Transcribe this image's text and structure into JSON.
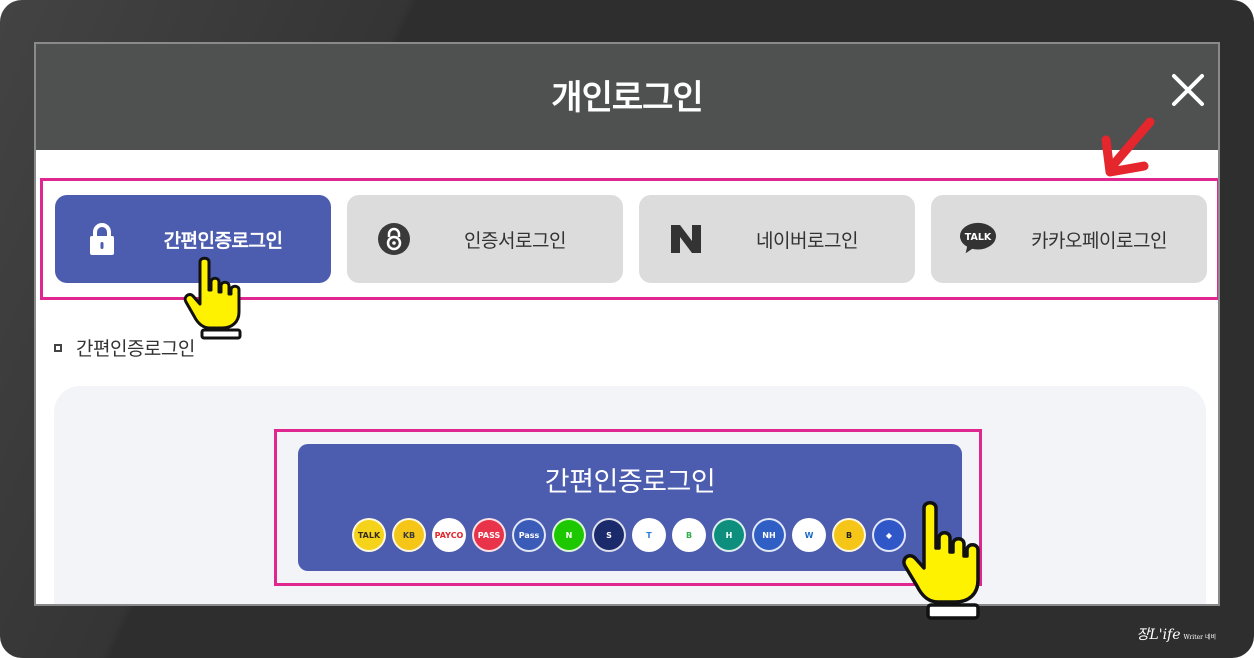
{
  "modal": {
    "title": "개인로그인"
  },
  "tabs": [
    {
      "label": "간편인증로그인",
      "icon": "lock-icon",
      "active": true
    },
    {
      "label": "인증서로그인",
      "icon": "certificate-icon",
      "active": false
    },
    {
      "label": "네이버로그인",
      "icon": "naver-icon",
      "icon_text": "N",
      "active": false
    },
    {
      "label": "카카오페이로그인",
      "icon": "kakaotalk-icon",
      "icon_text": "TALK",
      "active": false
    }
  ],
  "section": {
    "label": "간편인증로그인"
  },
  "simple_auth_button": {
    "label": "간편인증로그인",
    "providers": [
      {
        "name": "kakao-icon",
        "text": "TALK",
        "bg": "#f5d31a",
        "fg": "#3a2a1a"
      },
      {
        "name": "kb-icon",
        "text": "KB",
        "bg": "#f5c518",
        "fg": "#3a3a3a"
      },
      {
        "name": "payco-icon",
        "text": "PAYCO",
        "bg": "#ffffff",
        "fg": "#e2252b"
      },
      {
        "name": "pass-icon",
        "text": "PASS",
        "bg": "#e8334a",
        "fg": "#ffffff"
      },
      {
        "name": "samsung-pass-icon",
        "text": "Pass",
        "bg": "#3a5bb8",
        "fg": "#ffffff"
      },
      {
        "name": "naver-provider-icon",
        "text": "N",
        "bg": "#1ec800",
        "fg": "#ffffff"
      },
      {
        "name": "shinhan-icon",
        "text": "S",
        "bg": "#1b2a6b",
        "fg": "#ffffff"
      },
      {
        "name": "toss-icon",
        "text": "T",
        "bg": "#ffffff",
        "fg": "#2f7bd8"
      },
      {
        "name": "banksalad-icon",
        "text": "B",
        "bg": "#ffffff",
        "fg": "#2cb04a"
      },
      {
        "name": "hana-icon",
        "text": "H",
        "bg": "#0e8f7e",
        "fg": "#ffffff"
      },
      {
        "name": "nh-icon",
        "text": "NH",
        "bg": "#2f5fc4",
        "fg": "#ffffff"
      },
      {
        "name": "woori-icon",
        "text": "W",
        "bg": "#ffffff",
        "fg": "#1b6cc4"
      },
      {
        "name": "banksign-icon",
        "text": "B",
        "bg": "#f5c518",
        "fg": "#222222"
      },
      {
        "name": "shield-provider-icon",
        "text": "◆",
        "bg": "#2f57c8",
        "fg": "#ffffff"
      }
    ]
  },
  "colors": {
    "header_bg": "#4f5050",
    "active_tab": "#4c5caf",
    "inactive_tab": "#dcdcdc",
    "highlight": "#e0268f",
    "arrow": "#e5262c",
    "hand": "#fff200"
  },
  "watermark": {
    "text": "장L'ife",
    "sub": "Writer 네비"
  }
}
